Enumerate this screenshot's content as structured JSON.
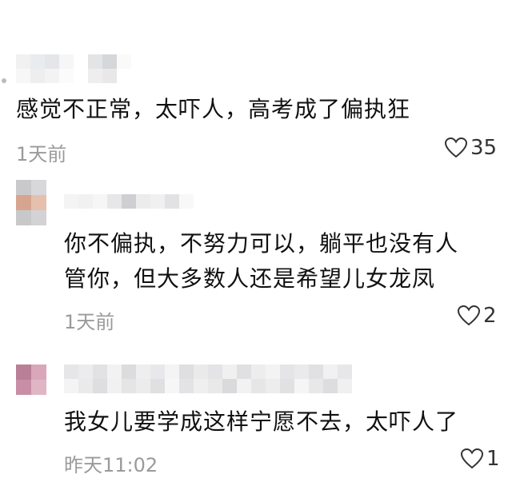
{
  "comments": [
    {
      "text": "感觉不正常，太吓人，高考成了偏执狂",
      "time": "1天前",
      "likes": "35",
      "icon": "heart-outline-icon"
    },
    {
      "text_line1": "你不偏执，不努力可以，躺平也没有人",
      "text_line2": "管你，但大多数人还是希望儿女龙凤",
      "time": "1天前",
      "likes": "2",
      "icon": "heart-outline-icon"
    },
    {
      "text": "我女儿要学成这样宁愿不去，太吓人了",
      "time": "昨天11:02",
      "likes": "1",
      "icon": "heart-outline-icon"
    }
  ]
}
